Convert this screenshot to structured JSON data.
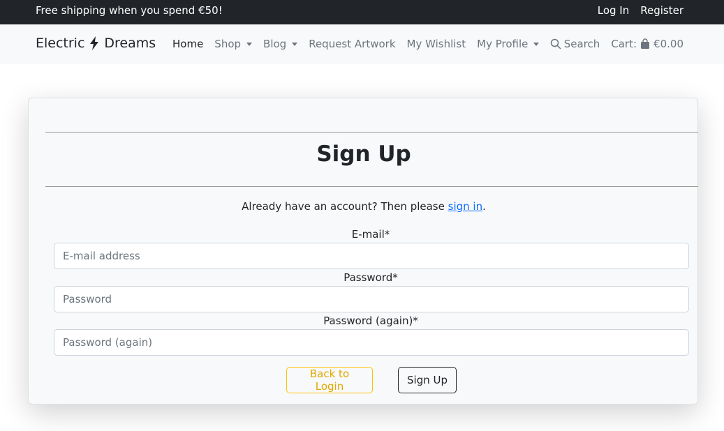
{
  "topbar": {
    "promo": "Free shipping when you spend €50!",
    "login": "Log In",
    "register": "Register"
  },
  "navbar": {
    "brand_left": "Electric",
    "brand_right": "Dreams",
    "brand_icon": "lightning-bolt-icon",
    "items": [
      {
        "label": "Home",
        "active": true,
        "dropdown": false
      },
      {
        "label": "Shop",
        "active": false,
        "dropdown": true
      },
      {
        "label": "Blog",
        "active": false,
        "dropdown": true
      },
      {
        "label": "Request Artwork",
        "active": false,
        "dropdown": false
      },
      {
        "label": "My Wishlist",
        "active": false,
        "dropdown": false
      },
      {
        "label": "My Profile",
        "active": false,
        "dropdown": true
      }
    ],
    "search": "Search",
    "cart_label": "Cart:",
    "cart_total": "€0.00"
  },
  "signup": {
    "title": "Sign Up",
    "already_text": "Already have an account? Then please ",
    "signin_link": "sign in",
    "period": ".",
    "email_label": "E-mail*",
    "email_placeholder": "E-mail address",
    "password_label": "Password*",
    "password_placeholder": "Password",
    "password2_label": "Password (again)*",
    "password2_placeholder": "Password (again)",
    "back_button": "Back to Login",
    "submit_button": "Sign Up"
  },
  "colors": {
    "topbar_bg": "#212529",
    "navbar_bg": "#f8f9fa",
    "link": "#0d6efd",
    "warning": "#ffc107"
  }
}
